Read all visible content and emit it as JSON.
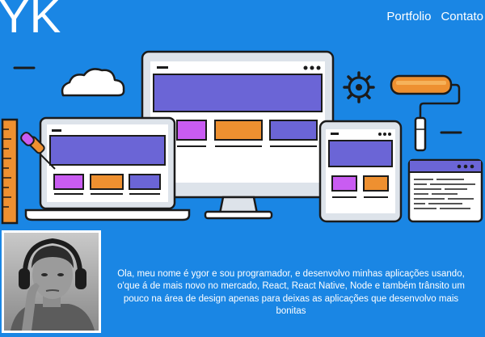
{
  "header": {
    "logo": "YK",
    "nav": [
      {
        "label": "Portfolio"
      },
      {
        "label": "Contato"
      }
    ]
  },
  "hero": {
    "illustration": "responsive-web-design-devices",
    "icons": [
      "cloud-icon",
      "gear-icon",
      "paint-roller-icon",
      "eyedropper-icon",
      "ruler-icon"
    ]
  },
  "about": {
    "photo": "profile-photo",
    "bio": "Ola, meu nome é ygor e sou programador, e desenvolvo minhas aplicações usando, o'que á de mais novo no mercado, React, React Native, Node e também trânsito um pouco na área de design apenas para deixas as aplicações que desenvolvo mais bonitas"
  },
  "colors": {
    "background": "#1a86e4",
    "purple": "#6b65d6",
    "magenta": "#c95cf2",
    "orange": "#ee9030",
    "screen": "#ffffff",
    "frame": "#dde3ea",
    "outline": "#1b1b1b"
  }
}
